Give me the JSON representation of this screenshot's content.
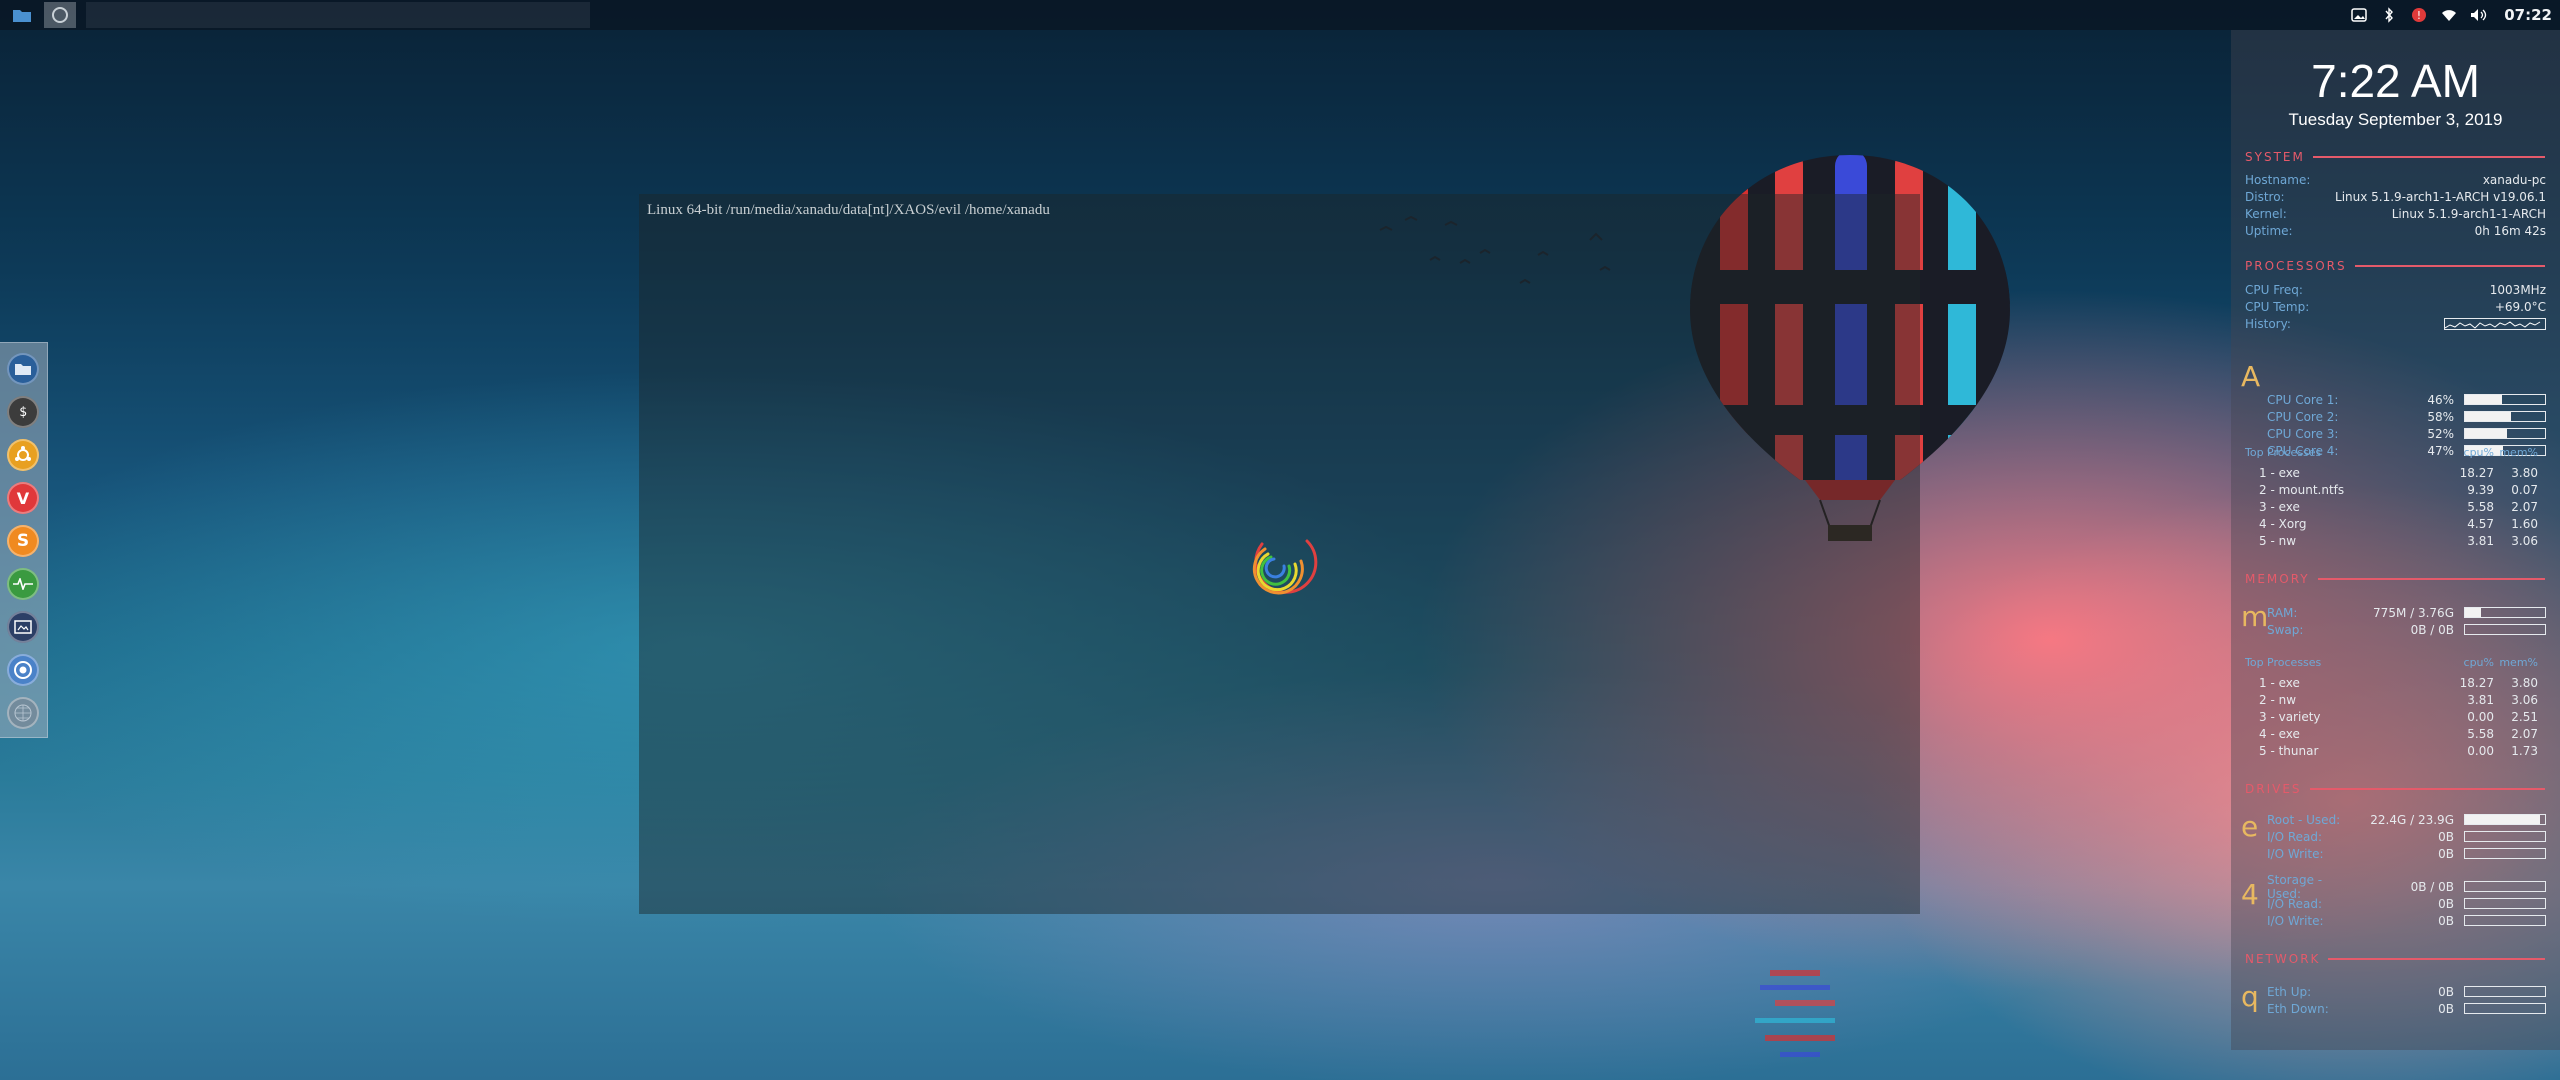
{
  "terminal": {
    "prompt": "Linux 64-bit /run/media/xanadu/data[nt]/XAOS/evil /home/xanadu"
  },
  "topbar": {
    "clock": "07:22"
  },
  "dock": {
    "items": [
      "files-app",
      "terminal-app",
      "ubuntu-app",
      "vivaldi-app",
      "sublime-app",
      "system-monitor-app",
      "screenshot-app",
      "chrome-app",
      "apps-grid"
    ]
  },
  "conky": {
    "time": "7:22 AM",
    "date": "Tuesday September  3, 2019",
    "system": {
      "title": "SYSTEM",
      "hostname_label": "Hostname:",
      "hostname": "xanadu-pc",
      "distro_label": "Distro:",
      "distro": "Linux 5.1.9-arch1-1-ARCH v19.06.1",
      "kernel_label": "Kernel:",
      "kernel": "Linux 5.1.9-arch1-1-ARCH",
      "uptime_label": "Uptime:",
      "uptime": "0h 16m 42s"
    },
    "processors": {
      "title": "PROCESSORS",
      "freq_label": "CPU Freq:",
      "freq": "1003MHz",
      "temp_label": "CPU Temp:",
      "temp": "+69.0°C",
      "history_label": "History:",
      "big_letter": "A",
      "cores": [
        {
          "label": "CPU Core 1:",
          "value": "46%",
          "pct": 46
        },
        {
          "label": "CPU Core 2:",
          "value": "58%",
          "pct": 58
        },
        {
          "label": "CPU Core 3:",
          "value": "52%",
          "pct": 52
        },
        {
          "label": "CPU Core 4:",
          "value": "47%",
          "pct": 47
        }
      ],
      "top_label": "Top Processes",
      "col1": "cpu%",
      "col2": "mem%",
      "top": [
        {
          "name": "1 - exe",
          "a": "18.27",
          "b": "3.80"
        },
        {
          "name": "2 - mount.ntfs",
          "a": "9.39",
          "b": "0.07"
        },
        {
          "name": "3 - exe",
          "a": "5.58",
          "b": "2.07"
        },
        {
          "name": "4 - Xorg",
          "a": "4.57",
          "b": "1.60"
        },
        {
          "name": "5 - nw",
          "a": "3.81",
          "b": "3.06"
        }
      ]
    },
    "memory": {
      "title": "MEMORY",
      "big_letter": "m",
      "ram_label": "RAM:",
      "ram": "775M / 3.76G",
      "ram_pct": 20,
      "swap_label": "Swap:",
      "swap": "0B / 0B",
      "swap_pct": 0,
      "top_label": "Top Processes",
      "col1": "cpu%",
      "col2": "mem%",
      "top": [
        {
          "name": "1 - exe",
          "a": "18.27",
          "b": "3.80"
        },
        {
          "name": "2 - nw",
          "a": "3.81",
          "b": "3.06"
        },
        {
          "name": "3 - variety",
          "a": "0.00",
          "b": "2.51"
        },
        {
          "name": "4 - exe",
          "a": "5.58",
          "b": "2.07"
        },
        {
          "name": "5 - thunar",
          "a": "0.00",
          "b": "1.73"
        }
      ]
    },
    "drives": {
      "title": "DRIVES",
      "big_e": "e",
      "root_label": "Root - Used:",
      "root": "22.4G / 23.9G",
      "root_pct": 94,
      "root_read_label": "I/O Read:",
      "root_read": "0B",
      "root_write_label": "I/O Write:",
      "root_write": "0B",
      "big_4": "4",
      "home_label": "Storage - Used:",
      "home": "0B / 0B",
      "home_pct": 0,
      "home_read_label": "I/O Read:",
      "home_read": "0B",
      "home_write_label": "I/O Write:",
      "home_write": "0B"
    },
    "network": {
      "title": "NETWORK",
      "big_letter": "q",
      "up_label": "Eth Up:",
      "up": "0B",
      "down_label": "Eth Down:",
      "down": "0B"
    }
  }
}
